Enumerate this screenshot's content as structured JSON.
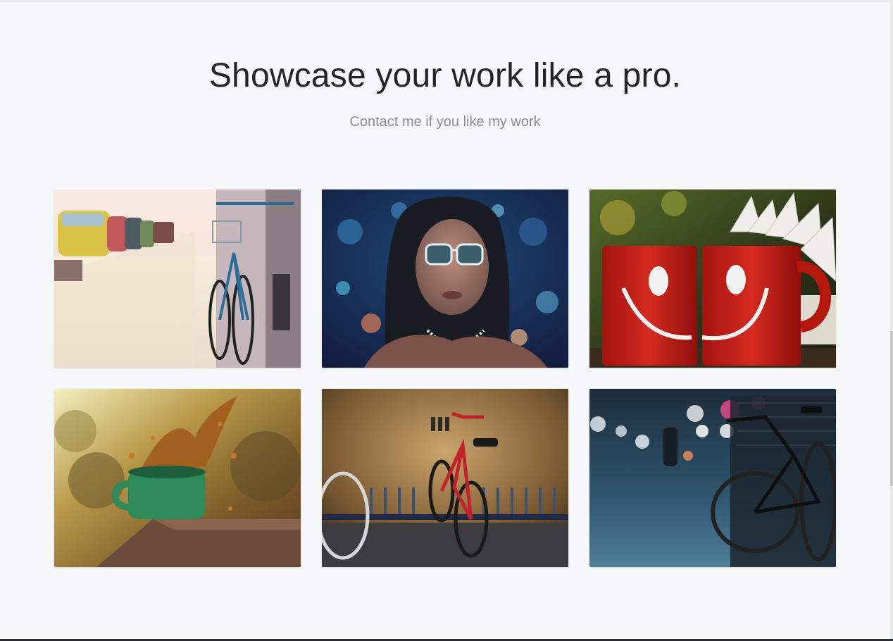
{
  "hero": {
    "title": "Showcase your work like a pro.",
    "subtitle": "Contact me if you like my work"
  },
  "gallery": {
    "items": [
      {
        "subject": "bicycle-on-sidewalk"
      },
      {
        "subject": "woman-with-sunglasses-bokeh"
      },
      {
        "subject": "red-smiley-mugs"
      },
      {
        "subject": "coffee-splash-green-cup"
      },
      {
        "subject": "red-bicycle-by-wall"
      },
      {
        "subject": "bicycle-night-street"
      }
    ]
  }
}
